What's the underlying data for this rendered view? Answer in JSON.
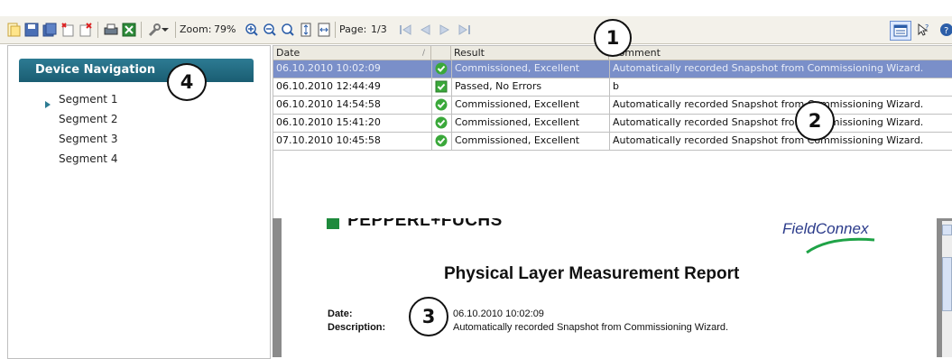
{
  "toolbar": {
    "zoom_label": "Zoom:",
    "zoom_value": "79%",
    "page_label": "Page:",
    "page_value": "1/3",
    "icons": [
      "new-icon",
      "save-icon",
      "save-as-icon",
      "new-doc-icon",
      "delete-doc-icon",
      "print-icon",
      "excel-export-icon",
      "wrench-icon",
      "dropdown-arrow-icon",
      "zoom-in-icon",
      "zoom-out-icon",
      "zoom-reset-icon",
      "fit-page-icon",
      "fit-width-icon",
      "first-page-icon",
      "prev-page-icon",
      "next-page-icon",
      "last-page-icon",
      "layout-icon",
      "pointer-help-icon",
      "help-icon"
    ]
  },
  "callouts": {
    "c1": "1",
    "c2": "2",
    "c3": "3",
    "c4": "4"
  },
  "nav": {
    "title": "Device Navigation",
    "items": [
      "Segment 1",
      "Segment 2",
      "Segment 3",
      "Segment 4"
    ]
  },
  "grid": {
    "columns": [
      "Date",
      "Result",
      "Comment"
    ],
    "rows": [
      {
        "date": "06.10.2010 10:02:09",
        "result": "Commissioned, Excellent",
        "comment": "Automatically recorded Snapshot from Commissioning Wizard.",
        "status": "check-circle"
      },
      {
        "date": "06.10.2010 12:44:49",
        "result": "Passed, No Errors",
        "comment": "b",
        "status": "check-square"
      },
      {
        "date": "06.10.2010 14:54:58",
        "result": "Commissioned, Excellent",
        "comment": "Automatically recorded Snapshot from Commissioning Wizard.",
        "status": "check-circle"
      },
      {
        "date": "06.10.2010 15:41:20",
        "result": "Commissioned, Excellent",
        "comment": "Automatically recorded Snapshot from Commissioning Wizard.",
        "status": "check-circle"
      },
      {
        "date": "07.10.2010 10:45:58",
        "result": "Commissioned, Excellent",
        "comment": "Automatically recorded Snapshot from Commissioning Wizard.",
        "status": "check-circle"
      }
    ]
  },
  "report": {
    "brand_left": "PEPPERL+FUCHS",
    "brand_right": "FieldConnex",
    "title": "Physical Layer Measurement Report",
    "date_label": "Date:",
    "date_value": "06.10.2010 10:02:09",
    "desc_label": "Description:",
    "desc_value": "Automatically recorded Snapshot from Commissioning Wizard."
  },
  "colors": {
    "accent": "#1a5d72",
    "selection": "#7a8fc9",
    "ok": "#3aa83a"
  }
}
